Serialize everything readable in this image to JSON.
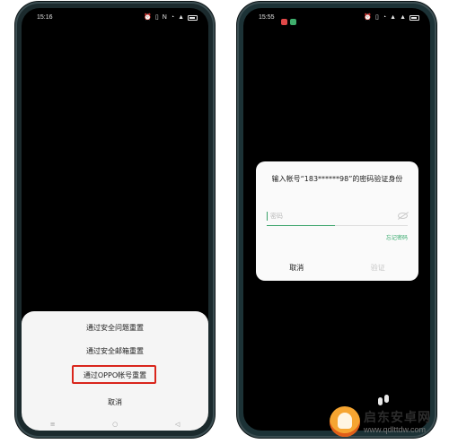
{
  "left_phone": {
    "status_time": "15:16",
    "status_icons": [
      "alarm-icon",
      "vibrate-icon",
      "nfc-icon",
      "wifi-icon",
      "signal-icon",
      "battery-icon"
    ],
    "sheet": {
      "items": [
        "通过安全问题重置",
        "通过安全邮箱重置",
        "通过OPPO帐号重置"
      ],
      "cancel_label": "取消",
      "highlight_color": "#d9261c"
    },
    "nav": {
      "menu": "≡",
      "home": "○",
      "back": "◁"
    }
  },
  "right_phone": {
    "status_time": "15:55",
    "notification_colors": [
      "#e04848",
      "#3fae6c"
    ],
    "status_icons": [
      "alarm-icon",
      "vibrate-icon",
      "wifi-icon",
      "signal-icon",
      "signal-icon",
      "battery-icon"
    ],
    "dialog": {
      "title": "输入帐号“183******98”的密码验证身份",
      "password_placeholder": "密码",
      "forgot_label": "忘记密码",
      "cancel_label": "取消",
      "confirm_label": "验证",
      "accent_color": "#3aa36a"
    }
  },
  "watermark": {
    "name": "启东安卓网",
    "url": "www.qdlttdw.com"
  }
}
